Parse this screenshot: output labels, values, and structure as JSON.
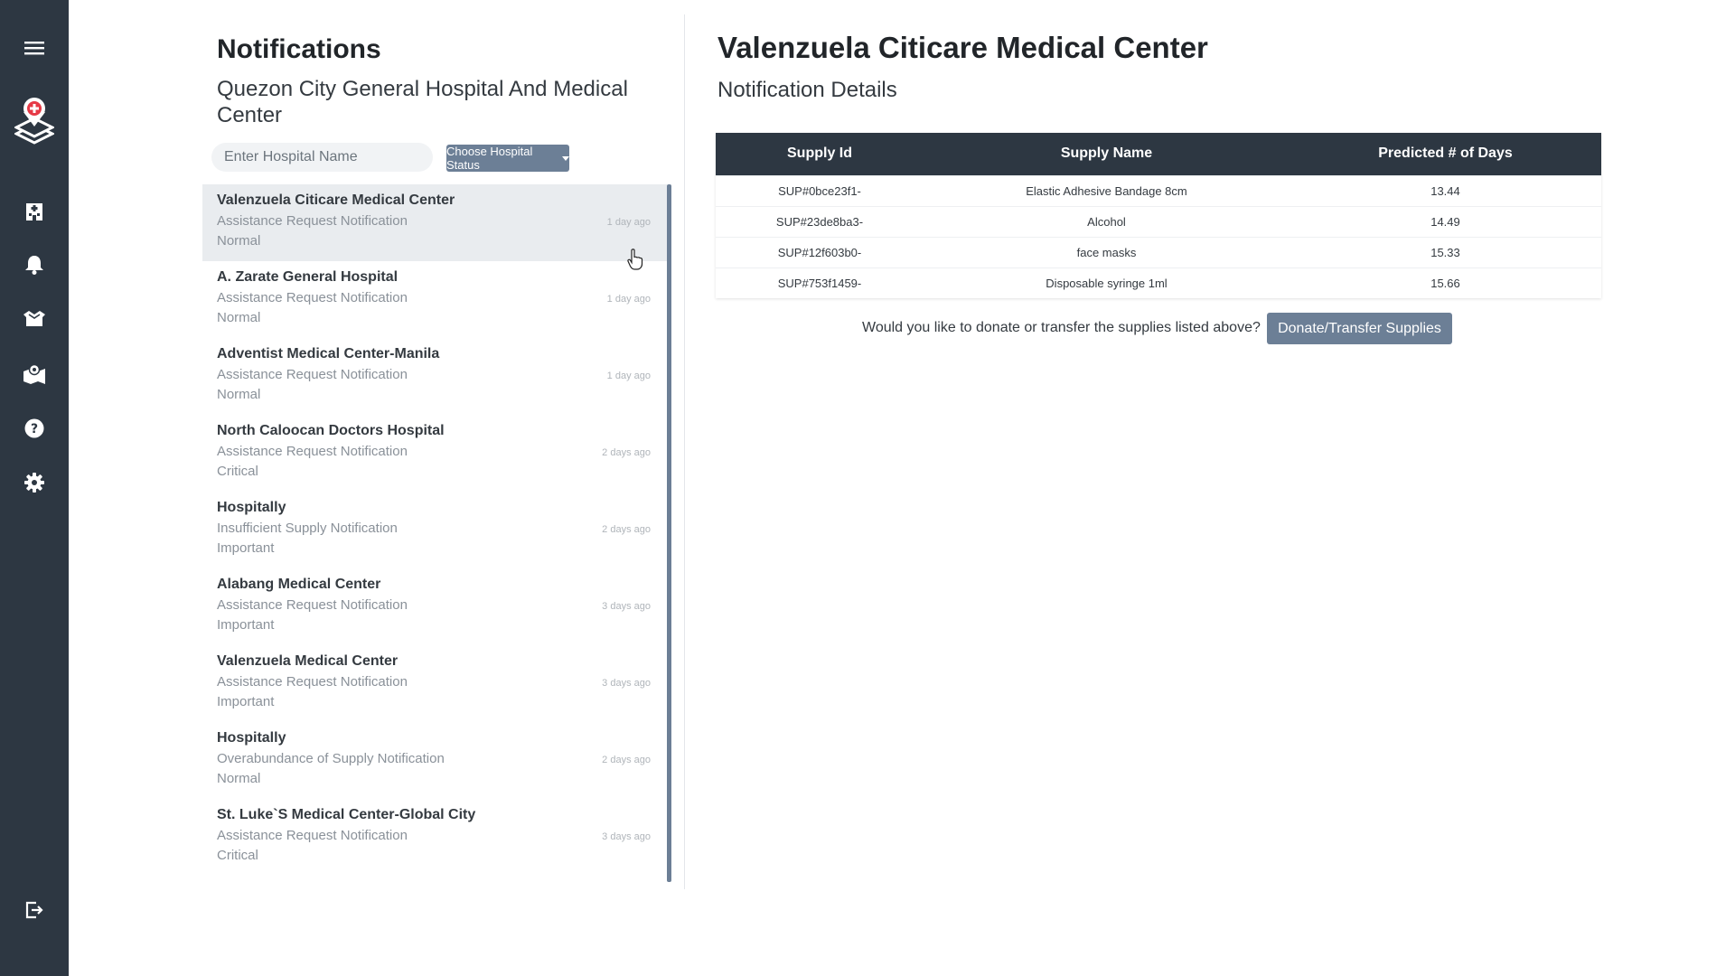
{
  "sidebar": {
    "items": [
      {
        "icon": "menu-icon"
      },
      {
        "icon": "logo-icon"
      },
      {
        "icon": "hospital-icon"
      },
      {
        "icon": "bell-icon"
      },
      {
        "icon": "supplies-icon"
      },
      {
        "icon": "map-icon"
      },
      {
        "icon": "help-icon"
      },
      {
        "icon": "gear-icon"
      },
      {
        "icon": "logout-icon"
      }
    ]
  },
  "list": {
    "title": "Notifications",
    "hospital": "Quezon City General Hospital And Medical Center",
    "search_placeholder": "Enter Hospital Name",
    "status_button": "Choose Hospital Status",
    "notifications": [
      {
        "name": "Valenzuela Citicare Medical Center",
        "type": "Assistance Request Notification",
        "status": "Normal",
        "time": "1 day ago",
        "active": true
      },
      {
        "name": "A. Zarate General Hospital",
        "type": "Assistance Request Notification",
        "status": "Normal",
        "time": "1 day ago"
      },
      {
        "name": "Adventist Medical Center-Manila",
        "type": "Assistance Request Notification",
        "status": "Normal",
        "time": "1 day ago"
      },
      {
        "name": "North Caloocan Doctors Hospital",
        "type": "Assistance Request Notification",
        "status": "Critical",
        "time": "2 days ago"
      },
      {
        "name": "Hospitally",
        "type": "Insufficient Supply Notification",
        "status": "Important",
        "time": "2 days ago"
      },
      {
        "name": "Alabang Medical Center",
        "type": "Assistance Request Notification",
        "status": "Important",
        "time": "3 days ago"
      },
      {
        "name": "Valenzuela Medical Center",
        "type": "Assistance Request Notification",
        "status": "Important",
        "time": "3 days ago"
      },
      {
        "name": "Hospitally",
        "type": "Overabundance of Supply Notification",
        "status": "Normal",
        "time": "2 days ago"
      },
      {
        "name": "St. Luke`S Medical Center-Global City",
        "type": "Assistance Request Notification",
        "status": "Critical",
        "time": "3 days ago"
      }
    ]
  },
  "detail": {
    "title": "Valenzuela Citicare Medical Center",
    "subtitle": "Notification Details",
    "columns": [
      "Supply Id",
      "Supply Name",
      "Predicted # of Days"
    ],
    "rows": [
      [
        "SUP#0bce23f1-",
        "Elastic Adhesive Bandage 8cm",
        "13.44"
      ],
      [
        "SUP#23de8ba3-",
        "Alcohol",
        "14.49"
      ],
      [
        "SUP#12f603b0-",
        "face masks",
        "15.33"
      ],
      [
        "SUP#753f1459-",
        "Disposable syringe 1ml",
        "15.66"
      ]
    ],
    "question": "Would you like to donate or transfer the supplies listed above?",
    "button": "Donate/Transfer Supplies"
  },
  "colors": {
    "sidebar": "#2d3742",
    "accent": "#6c7f96",
    "active_row": "#e9ecef"
  }
}
